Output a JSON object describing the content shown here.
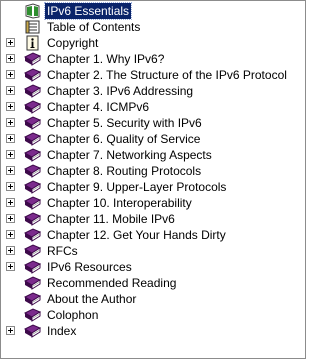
{
  "tree": {
    "items": [
      {
        "label": "IPv6 Essentials",
        "icon": "book-page-icon",
        "expandable": false,
        "selected": true
      },
      {
        "label": "Table of Contents",
        "icon": "toc-icon",
        "expandable": false
      },
      {
        "label": "Copyright",
        "icon": "info-icon",
        "expandable": true
      },
      {
        "label": "Chapter 1.  Why IPv6?",
        "icon": "book-icon",
        "expandable": true
      },
      {
        "label": "Chapter 2.  The Structure of the IPv6 Protocol",
        "icon": "book-icon",
        "expandable": true
      },
      {
        "label": "Chapter 3.  IPv6 Addressing",
        "icon": "book-icon",
        "expandable": true
      },
      {
        "label": "Chapter 4.  ICMPv6",
        "icon": "book-icon",
        "expandable": true
      },
      {
        "label": "Chapter 5.  Security with IPv6",
        "icon": "book-icon",
        "expandable": true
      },
      {
        "label": "Chapter 6.  Quality of Service",
        "icon": "book-icon",
        "expandable": true
      },
      {
        "label": "Chapter 7.  Networking Aspects",
        "icon": "book-icon",
        "expandable": true
      },
      {
        "label": "Chapter 8.  Routing Protocols",
        "icon": "book-icon",
        "expandable": true
      },
      {
        "label": "Chapter 9.  Upper-Layer Protocols",
        "icon": "book-icon",
        "expandable": true
      },
      {
        "label": "Chapter 10.  Interoperability",
        "icon": "book-icon",
        "expandable": true
      },
      {
        "label": "Chapter 11.  Mobile IPv6",
        "icon": "book-icon",
        "expandable": true
      },
      {
        "label": "Chapter 12.  Get Your Hands Dirty",
        "icon": "book-icon",
        "expandable": true
      },
      {
        "label": "RFCs",
        "icon": "book-icon",
        "expandable": true
      },
      {
        "label": "IPv6 Resources",
        "icon": "book-icon",
        "expandable": true
      },
      {
        "label": "Recommended Reading",
        "icon": "book-icon",
        "expandable": false
      },
      {
        "label": "About the Author",
        "icon": "book-icon",
        "expandable": false
      },
      {
        "label": "Colophon",
        "icon": "book-icon",
        "expandable": false
      },
      {
        "label": "Index",
        "icon": "book-icon",
        "expandable": true
      }
    ]
  },
  "colors": {
    "book": "#7b2a8c",
    "book_dark": "#3d0a4a",
    "selection": "#0a246a"
  }
}
